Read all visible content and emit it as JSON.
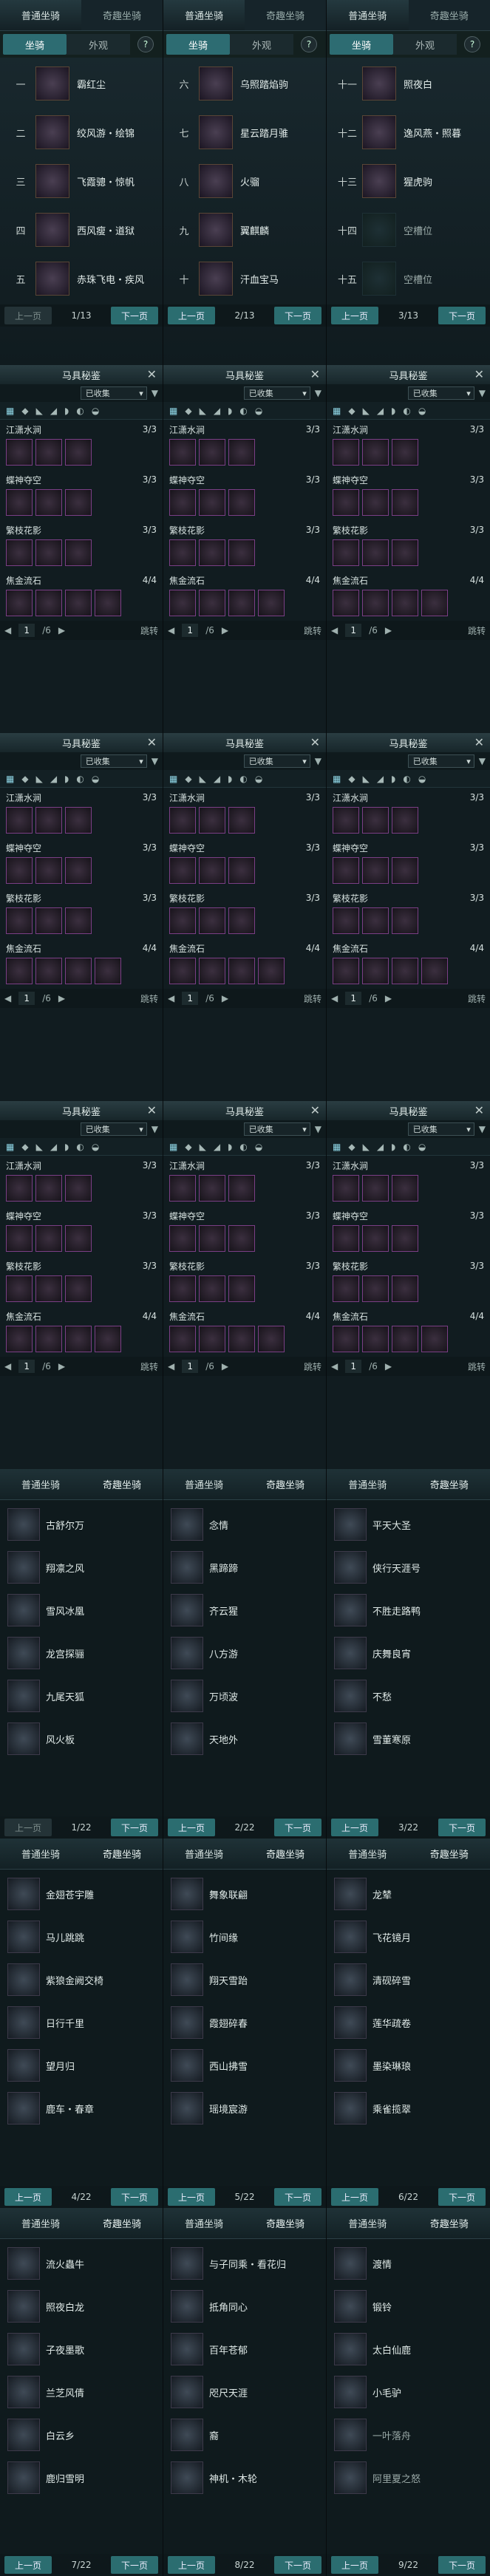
{
  "mount_panels": [
    {
      "tabs": [
        "普通坐骑",
        "奇趣坐骑"
      ],
      "subtabs": [
        "坐骑",
        "外观"
      ],
      "help": "?",
      "rows": [
        [
          "一",
          "霸红尘"
        ],
        [
          "二",
          "绞风游・绘锦"
        ],
        [
          "三",
          "飞霞骢・惊帆"
        ],
        [
          "四",
          "西风瘦・道狱"
        ],
        [
          "五",
          "赤珠飞电・疾风"
        ]
      ],
      "prev": "上一页",
      "page": "1/13",
      "next": "下一页"
    },
    {
      "tabs": [
        "普通坐骑",
        "奇趣坐骑"
      ],
      "subtabs": [
        "坐骑",
        "外观"
      ],
      "help": "?",
      "rows": [
        [
          "六",
          "乌照踏焰驹"
        ],
        [
          "七",
          "星云踏月骓"
        ],
        [
          "八",
          "火骝"
        ],
        [
          "九",
          "翼麒麟"
        ],
        [
          "十",
          "汗血宝马"
        ]
      ],
      "prev": "上一页",
      "page": "2/13",
      "next": "下一页"
    },
    {
      "tabs": [
        "普通坐骑",
        "奇趣坐骑"
      ],
      "subtabs": [
        "坐骑",
        "外观"
      ],
      "help": "?",
      "rows": [
        [
          "十一",
          "照夜白"
        ],
        [
          "十二",
          "逸风燕・照暮"
        ],
        [
          "十三",
          "猩虎驹"
        ],
        [
          "十四",
          "空槽位"
        ],
        [
          "十五",
          "空槽位"
        ]
      ],
      "prev": "上一页",
      "page": "3/13",
      "next": "下一页"
    }
  ],
  "saddle_panel": {
    "title": "马具秘鉴",
    "close": "✕",
    "filter": "已收集",
    "groups": [
      [
        "江潇水涧",
        "3/3"
      ],
      [
        "蝶神夺空",
        "3/3"
      ],
      [
        "繁枝花影",
        "3/3"
      ],
      [
        "焦金流石",
        "4/4"
      ]
    ],
    "page_input": "1",
    "page_total": "/6",
    "jump": "跳转"
  },
  "fun_headers": [
    "普通坐骑",
    "奇趣坐骑"
  ],
  "fun_panels": [
    {
      "names": [
        "古舒尔万",
        "翔凛之风",
        "雪风冰凰",
        "龙宫探骊",
        "九尾天狐",
        "风火板"
      ],
      "prev": "上一页",
      "page": "1/22",
      "next": "下一页"
    },
    {
      "names": [
        "念情",
        "黑蹄蹄",
        "齐云猩",
        "八方游",
        "万顷波",
        "天地外"
      ],
      "prev": "上一页",
      "page": "2/22",
      "next": "下一页"
    },
    {
      "names": [
        "平天大圣",
        "侠行天涯号",
        "不胜走路鸭",
        "庆舞良宵",
        "不愁",
        "雪董寒原"
      ],
      "prev": "上一页",
      "page": "3/22",
      "next": "下一页"
    },
    {
      "names": [
        "金翅苍宇雕",
        "马儿跳跳",
        "紫狼金阙交椅",
        "日行千里",
        "望月归",
        "鹿车・春章"
      ],
      "prev": "上一页",
      "page": "4/22",
      "next": "下一页"
    },
    {
      "names": [
        "舞象联翩",
        "竹间缘",
        "翔天雪跆",
        "霞翅碎春",
        "西山拂雪",
        "瑶境宸游"
      ],
      "prev": "上一页",
      "page": "5/22",
      "next": "下一页"
    },
    {
      "names": [
        "龙辇",
        "飞花镜月",
        "清砚碎雪",
        "莲华疏卷",
        "墨染琳琅",
        "乘雀揽翠"
      ],
      "prev": "上一页",
      "page": "6/22",
      "next": "下一页"
    },
    {
      "names": [
        "流火蟲牛",
        "照夜白龙",
        "子夜墨歌",
        "兰芝风倩",
        "白云乡",
        "鹿归雪明"
      ],
      "prev": "上一页",
      "page": "7/22",
      "next": "下一页"
    },
    {
      "names": [
        "与子同乘・看花归",
        "抵角同心",
        "百年苍郁",
        "咫尺天涯",
        "裔",
        "神机・木轮"
      ],
      "prev": "上一页",
      "page": "8/22",
      "next": "下一页"
    },
    {
      "names": [
        "渡情",
        "锻铃",
        "太白仙鹿",
        "小毛驴",
        "一叶落舟",
        "阿里夏之怒"
      ],
      "prev": "上一页",
      "page": "9/22",
      "next": "下一页"
    }
  ]
}
